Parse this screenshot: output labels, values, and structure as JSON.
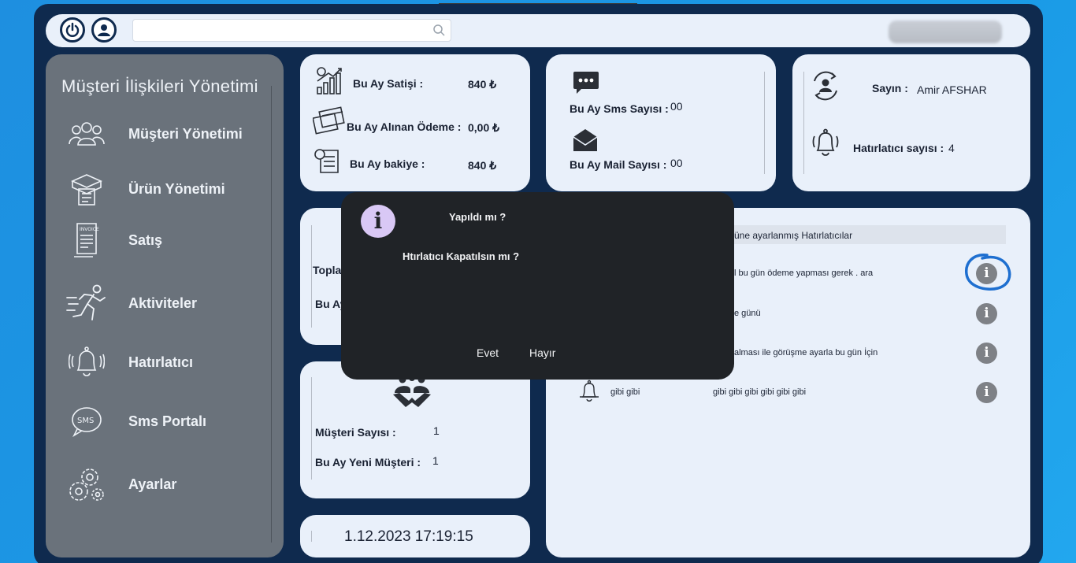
{
  "header": {
    "search_placeholder": ""
  },
  "sidebar": {
    "title": "Müşteri İlişkileri Yönetimi",
    "items": [
      {
        "label": "Müşteri Yönetimi",
        "icon": "users-icon"
      },
      {
        "label": "Ürün Yönetimi",
        "icon": "product-box-icon"
      },
      {
        "label": "Satış",
        "icon": "invoice-icon"
      },
      {
        "label": "Aktiviteler",
        "icon": "running-person-icon"
      },
      {
        "label": "Hatırlatıcı",
        "icon": "bell-icon"
      },
      {
        "label": "Sms Portalı",
        "icon": "sms-icon"
      },
      {
        "label": "Ayarlar",
        "icon": "gears-icon"
      }
    ]
  },
  "sales_card": {
    "monthly_sales_label": "Bu Ay Satişi :",
    "monthly_sales_value": "840 ₺",
    "payment_label": "Bu Ay Alınan Ödeme :",
    "payment_value": "0,00 ₺",
    "balance_label": "Bu Ay bakiye :",
    "balance_value": "840 ₺"
  },
  "messages_card": {
    "sms_label": "Bu Ay Sms Sayısı :",
    "sms_value": "00",
    "mail_label": "Bu Ay Mail Sayısı :",
    "mail_value": "00"
  },
  "user_card": {
    "greeting_label": "Sayın :",
    "user_name": "Amir AFSHAR",
    "reminder_count_label": "Hatırlatıcı sayısı :",
    "reminder_count_value": "4"
  },
  "totals_card": {
    "total_label_partial": "Topla",
    "month_label_partial": "Bu Ay"
  },
  "customers_card": {
    "customer_count_label": "Müşteri Sayısı :",
    "customer_count_value": "1",
    "new_customers_label": "Bu Ay Yeni Müşteri :",
    "new_customers_value": "1"
  },
  "clock": {
    "datetime": "1.12.2023 17:19:15"
  },
  "reminders": {
    "header_partial": "üne ayarlanmış Hatırlatıcılar",
    "rows": [
      {
        "title": "",
        "text": "l bu gün ödeme yapması gerek . ara"
      },
      {
        "title": "",
        "text": "e günü"
      },
      {
        "title": "",
        "text": "alması ile görüşme ayarla bu gün İçin"
      },
      {
        "title": "gibi gibi",
        "text": "gibi gibi gibi gibi gibi gibi"
      }
    ]
  },
  "dialog": {
    "title": "Yapıldı mı ?",
    "message": "Htırlatıcı Kapatılsın mı ?",
    "yes_label": "Evet",
    "no_label": "Hayır"
  },
  "colors": {
    "background": "#1a9ae6",
    "frame": "#0f2a4e",
    "card": "#e9f0fa",
    "sidebar": "#6a727b",
    "dialog": "#202327",
    "info_icon_badge": "#d9c8f5",
    "highlight_ring": "#1e6fd0"
  }
}
